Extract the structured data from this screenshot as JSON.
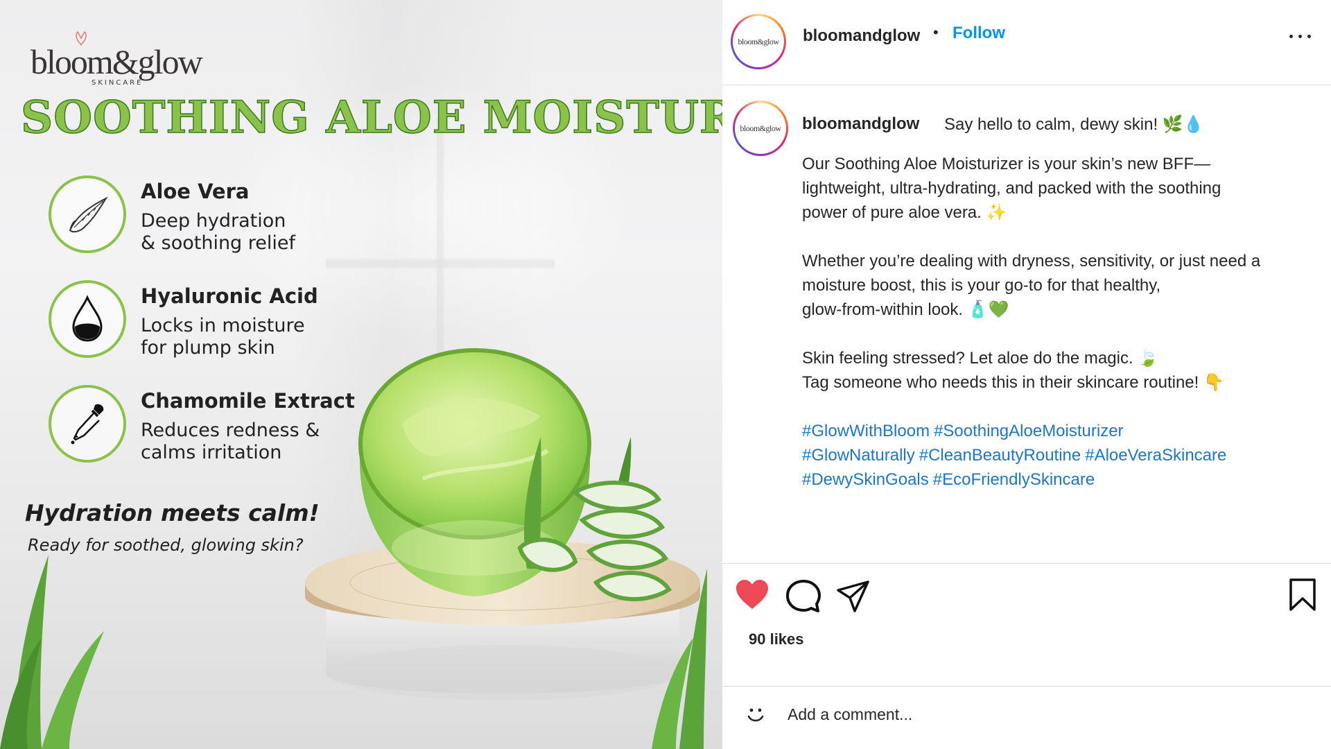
{
  "post_image": {
    "logo_text": "bloom&glow",
    "logo_subtext": "SKINCARE",
    "title": "SOOTHING ALOE MOISTURIZER",
    "features": [
      {
        "title": "Aloe Vera",
        "description": "Deep hydration\n& soothing relief",
        "icon": "aloe-leaf-icon"
      },
      {
        "title": "Hyaluronic Acid",
        "description": "Locks in moisture\nfor plump skin",
        "icon": "water-drop-icon"
      },
      {
        "title": "Chamomile Extract",
        "description": "Reduces redness &\ncalms irritation",
        "icon": "dropper-icon"
      }
    ],
    "tagline": "Hydration meets calm!",
    "subtagline": "Ready for soothed, glowing skin?"
  },
  "header": {
    "avatar_text": "bloom&glow",
    "username": "bloomandglow",
    "separator": "•",
    "follow_label": "Follow"
  },
  "caption": {
    "username": "bloomandglow",
    "first_line": "Say hello to calm, dewy skin! 🌿💧",
    "paragraphs": [
      "Our Soothing Aloe Moisturizer is your skin’s new BFF—\nlightweight, ultra-hydrating, and packed with the soothing\npower of pure aloe vera. ✨",
      "Whether you’re dealing with dryness, sensitivity, or just need a\nmoisture boost, this is your go-to for that healthy,\nglow-from-within look. 🧴💚",
      "Skin feeling stressed? Let aloe do the magic. 🍃\nTag someone who needs this in their skincare routine! 👇"
    ],
    "hashtags": [
      "#GlowWithBloom",
      "#SoothingAloeMoisturizer",
      "#GlowNaturally",
      "#CleanBeautyRoutine",
      "#AloeVeraSkincare",
      "#DewySkinGoals",
      "#EcoFriendlySkincare"
    ]
  },
  "actions": {
    "likes": "90 likes",
    "liked": true,
    "like_color": "#ed4956",
    "icons": [
      "heart-icon",
      "comment-icon",
      "share-icon",
      "bookmark-icon"
    ]
  },
  "comment": {
    "placeholder": "Add a comment..."
  },
  "colors": {
    "accent_green": "#8bc34a",
    "link_blue": "#0095f6",
    "hashtag_blue": "#1976d2"
  }
}
